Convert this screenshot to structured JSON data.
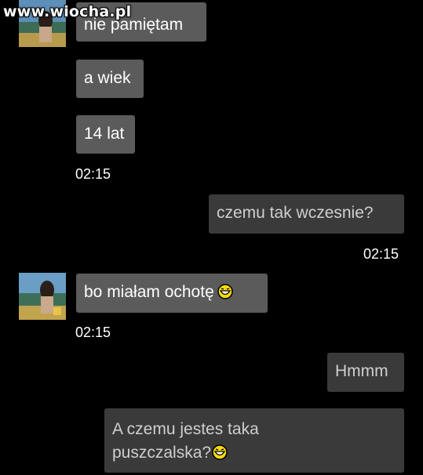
{
  "watermark": "www.wiocha.pl",
  "messages": [
    {
      "text": "nie pamiętam"
    },
    {
      "text": "a wiek"
    },
    {
      "text": "14 lat"
    },
    {
      "time": "02:15"
    },
    {
      "text": "czemu tak wczesnie?"
    },
    {
      "time": "02:15"
    },
    {
      "text": "bo miałam ochotę"
    },
    {
      "time": "02:15"
    },
    {
      "text": "Hmmm"
    },
    {
      "line1": "A czemu jestes taka",
      "line2": "puszczalska?"
    }
  ],
  "icons": {
    "smiley": "laughing-smiley-icon",
    "avatar": "contact-avatar"
  }
}
